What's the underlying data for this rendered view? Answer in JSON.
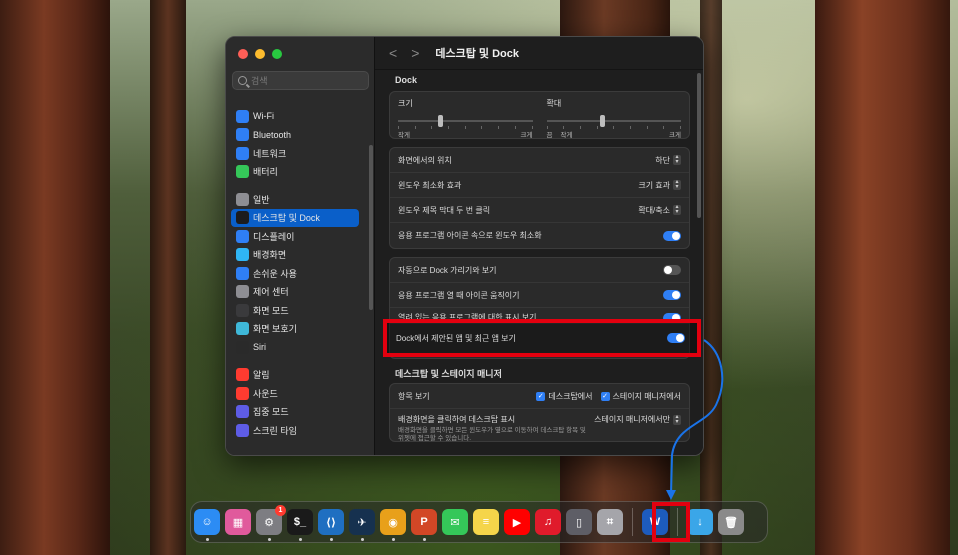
{
  "window": {
    "title": "데스크탑 및 Dock",
    "back_symbol": "<",
    "forward_symbol": ">"
  },
  "search": {
    "placeholder": "검색"
  },
  "sidebar": {
    "groups": [
      [
        {
          "label": "Wi-Fi",
          "icon": "wifi-icon",
          "color": "#2f7ff5"
        },
        {
          "label": "Bluetooth",
          "icon": "bluetooth-icon",
          "color": "#2f7ff5"
        },
        {
          "label": "네트워크",
          "icon": "globe-icon",
          "color": "#2f7ff5"
        },
        {
          "label": "배터리",
          "icon": "battery-icon",
          "color": "#35c759"
        }
      ],
      [
        {
          "label": "일반",
          "icon": "gear-icon",
          "color": "#8e8e93"
        },
        {
          "label": "데스크탑 및 Dock",
          "icon": "dock-icon",
          "color": "#1c1c1e",
          "active": true
        },
        {
          "label": "디스플레이",
          "icon": "sun-icon",
          "color": "#2f7ff5"
        },
        {
          "label": "배경화면",
          "icon": "flower-icon",
          "color": "#2fb5f5"
        },
        {
          "label": "손쉬운 사용",
          "icon": "accessibility-icon",
          "color": "#2f7ff5"
        },
        {
          "label": "제어 센터",
          "icon": "control-center-icon",
          "color": "#8e8e93"
        },
        {
          "label": "화면 모드",
          "icon": "moon-icon",
          "color": "#3a3a3c"
        },
        {
          "label": "화면 보호기",
          "icon": "screensaver-icon",
          "color": "#3fb8d8"
        },
        {
          "label": "Siri",
          "icon": "siri-icon",
          "color": "#2a2a2a"
        }
      ],
      [
        {
          "label": "알림",
          "icon": "bell-icon",
          "color": "#ff3b30"
        },
        {
          "label": "사운드",
          "icon": "speaker-icon",
          "color": "#ff3b30"
        },
        {
          "label": "집중 모드",
          "icon": "moon-icon",
          "color": "#5e5ce6"
        },
        {
          "label": "스크린 타임",
          "icon": "hourglass-icon",
          "color": "#5e5ce6"
        }
      ]
    ]
  },
  "dock_section": {
    "title": "Dock",
    "size_label": "크기",
    "size_small": "작게",
    "size_large": "크게",
    "size_value": 0.3,
    "magnify_label": "확대",
    "magnify_off": "끔",
    "magnify_small": "작게",
    "magnify_large": "크게",
    "magnify_value": 0.4,
    "rows": [
      {
        "label": "화면에서의 위치",
        "value": "하단"
      },
      {
        "label": "윈도우 최소화 효과",
        "value": "크기 효과"
      },
      {
        "label": "윈도우 제목 막대 두 번 클릭",
        "value": "확대/축소"
      },
      {
        "label": "응용 프로그램 아이콘 속으로 윈도우 최소화",
        "toggle": true
      }
    ],
    "toggles": [
      {
        "label": "자동으로 Dock 가리기와 보기",
        "on": false
      },
      {
        "label": "응용 프로그램 열 때 아이콘 움직이기",
        "on": true
      },
      {
        "label": "열려 있는 응용 프로그램에 대한 표시 보기",
        "on": true
      }
    ]
  },
  "highlight_row": {
    "label": "Dock에서 제안된 앱 및 최근 앱 보기",
    "on": true
  },
  "stage_section": {
    "title": "데스크탑 및 스테이지 매니저",
    "show_items_label": "항목 보기",
    "check_desktop": "데스크탑에서",
    "check_stage": "스테이지 매니저에서",
    "click_wallpaper_label": "배경화면을 클릭하여 데스크탑 표시",
    "click_wallpaper_value": "스테이지 매니저에서만",
    "click_wallpaper_desc": "배경화면을 클릭하면 모든 윈도우가 옆으로 이동하여 데스크탑 항목 및 위젯에 접근할 수 있습니다."
  },
  "dock_apps": [
    {
      "name": "finder",
      "glyph": "☺",
      "color": "#2c8cf4",
      "running": true
    },
    {
      "name": "launchpad",
      "glyph": "▦",
      "color": "#e05a9c",
      "running": false
    },
    {
      "name": "system-settings",
      "glyph": "⚙",
      "color": "#7d7d82",
      "running": true,
      "badge": "1"
    },
    {
      "name": "terminal",
      "glyph": "$_",
      "color": "#1a1a1a",
      "running": true
    },
    {
      "name": "vscode",
      "glyph": "⟨⟩",
      "color": "#1f6fc1",
      "running": true
    },
    {
      "name": "app-bird",
      "glyph": "✈",
      "color": "#16314f",
      "running": true
    },
    {
      "name": "chrome",
      "glyph": "◉",
      "color": "#e8a01a",
      "running": true
    },
    {
      "name": "powerpoint",
      "glyph": "P",
      "color": "#d24726",
      "running": true
    },
    {
      "name": "messages",
      "glyph": "✉",
      "color": "#35c759",
      "running": false
    },
    {
      "name": "notes",
      "glyph": "≡",
      "color": "#f5d54a",
      "running": false
    },
    {
      "name": "youtube",
      "glyph": "▶",
      "color": "#ff0000",
      "running": false
    },
    {
      "name": "youtube-music",
      "glyph": "♫",
      "color": "#e01b2b",
      "running": false
    },
    {
      "name": "iphone-mirroring",
      "glyph": "▯",
      "color": "#5e5e66",
      "running": false
    },
    {
      "name": "screenshot",
      "glyph": "⌗",
      "color": "#a5a5aa",
      "running": false
    }
  ],
  "dock_recent": {
    "name": "word",
    "glyph": "W",
    "color": "#1d5bbd"
  },
  "dock_right": [
    {
      "name": "downloads",
      "glyph": "↓",
      "color": "#3aa6e8"
    },
    {
      "name": "trash",
      "glyph": "🗑",
      "color": "#8a8a8a"
    }
  ]
}
